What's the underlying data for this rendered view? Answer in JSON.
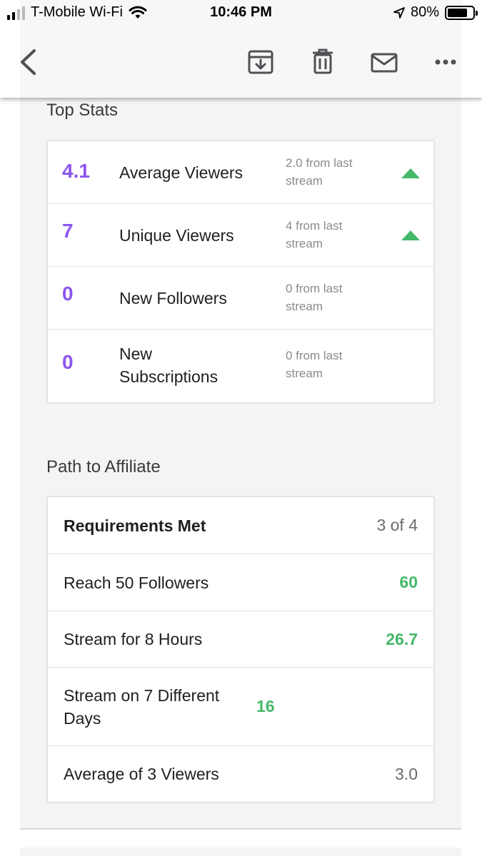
{
  "status_bar": {
    "carrier": "T-Mobile Wi-Fi",
    "time": "10:46 PM",
    "battery": "80%",
    "battery_level": 0.8
  },
  "toolbar": {
    "icons": [
      "back-icon",
      "archive-icon",
      "trash-icon",
      "mail-icon",
      "more-icon"
    ]
  },
  "top_stats": {
    "title": "Top Stats",
    "items": [
      {
        "value": "4.1",
        "label": "Average Viewers",
        "change": "2.0 from last stream",
        "trend": "up"
      },
      {
        "value": "7",
        "label": "Unique Viewers",
        "change": "4 from last stream",
        "trend": "up"
      },
      {
        "value": "0",
        "label": "New Followers",
        "change": "0 from last stream",
        "trend": "none"
      },
      {
        "value": "0",
        "label": "New Subscriptions",
        "change": "0 from last stream",
        "trend": "none"
      }
    ]
  },
  "affiliate": {
    "title": "Path to Affiliate",
    "header": {
      "label": "Requirements Met",
      "value": "3 of 4"
    },
    "requirements": [
      {
        "label": "Reach 50 Followers",
        "value": "60",
        "met": true
      },
      {
        "label": "Stream for 8 Hours",
        "value": "26.7",
        "met": true
      },
      {
        "label": "Stream on 7 Different Days",
        "value": "16",
        "met": true
      },
      {
        "label": "Average of 3 Viewers",
        "value": "3.0",
        "met": false
      }
    ]
  },
  "colors": {
    "accent_purple": "#8c55f0",
    "success_green": "#45b86a",
    "muted_text": "#8a8a90"
  }
}
